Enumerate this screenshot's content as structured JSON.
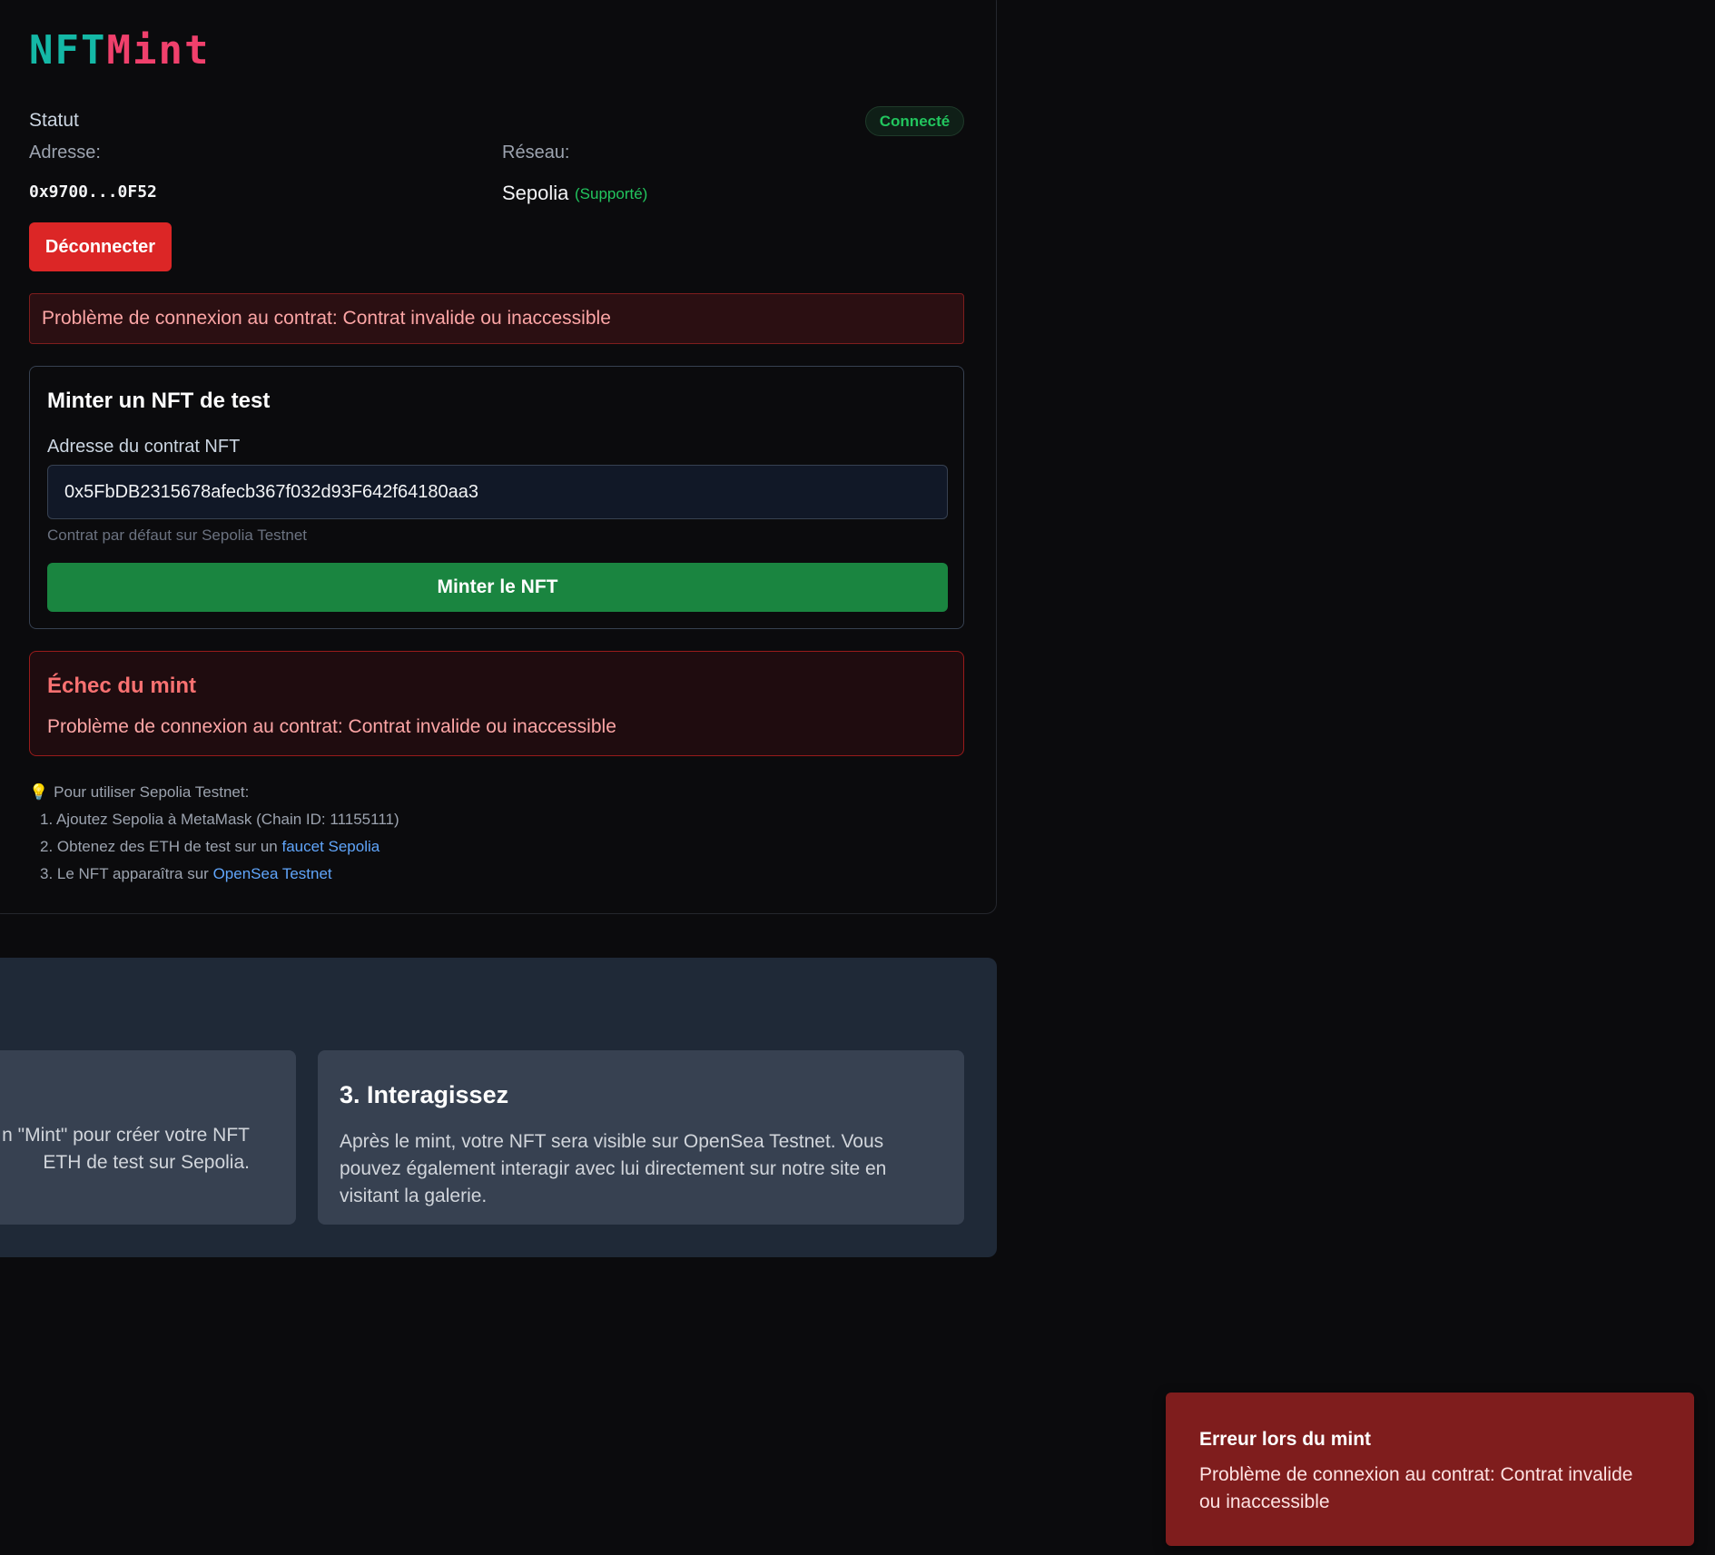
{
  "logo": {
    "part1": "NFT",
    "part2": "Mint"
  },
  "status": {
    "label": "Statut",
    "badge": "Connecté"
  },
  "address": {
    "label": "Adresse:",
    "value": "0x9700...0F52"
  },
  "network": {
    "label": "Réseau:",
    "value": "Sepolia",
    "support": "(Supporté)"
  },
  "disconnect_label": "Déconnecter",
  "alert_banner": "Problème de connexion au contrat: Contrat invalide ou inaccessible",
  "mint_form": {
    "title": "Minter un NFT de test",
    "field_label": "Adresse du contrat NFT",
    "contract_value": "0x5FbDB2315678afecb367f032d93F642f64180aa3",
    "hint": "Contrat par défaut sur Sepolia Testnet",
    "button_label": "Minter le NFT"
  },
  "mint_error": {
    "title": "Échec du mint",
    "message": "Problème de connexion au contrat: Contrat invalide ou inaccessible"
  },
  "tips": {
    "icon": "lightbulb-icon",
    "intro": "Pour utiliser Sepolia Testnet:",
    "step1": "1. Ajoutez Sepolia à MetaMask (Chain ID: 11155111)",
    "step2_prefix": "2. Obtenez des ETH de test sur un ",
    "step2_link": "faucet Sepolia",
    "step3_prefix": "3. Le NFT apparaîtra sur ",
    "step3_link": "OpenSea Testnet"
  },
  "steps": {
    "left_line1": "n \"Mint\" pour créer votre NFT",
    "left_line2": " ETH de test sur Sepolia.",
    "card3_title": "3. Interagissez",
    "card3_text": "Après le mint, votre NFT sera visible sur OpenSea Testnet. Vous pouvez également interagir avec lui directement sur notre site en visitant la galerie."
  },
  "toast": {
    "title": "Erreur lors du mint",
    "message": "Problème de connexion au contrat: Contrat invalide ou inaccessible"
  },
  "colors": {
    "background": "#0b0b0d",
    "accent_teal": "#14b8a6",
    "accent_pink": "#f0406c",
    "success": "#22c55e",
    "danger": "#dc2626",
    "mint_green": "#1a8540",
    "link": "#60a5fa"
  }
}
